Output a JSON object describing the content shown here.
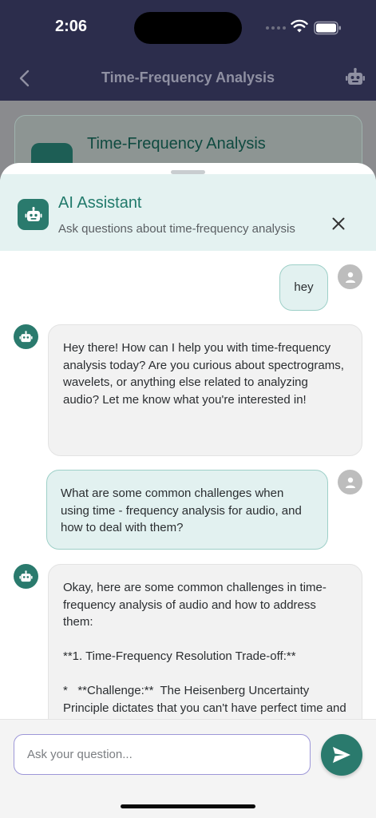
{
  "status_bar": {
    "time": "2:06"
  },
  "app_bar": {
    "title": "Time-Frequency Analysis"
  },
  "background_card": {
    "title": "Time-Frequency Analysis"
  },
  "assistant": {
    "title": "AI Assistant",
    "subtitle": "Ask questions about time-frequency analysis"
  },
  "messages": [
    {
      "role": "user",
      "text": "hey"
    },
    {
      "role": "bot",
      "text": "Hey there! How can I help you with time-frequency analysis today? Are you curious about spectrograms, wavelets, or anything else related to analyzing audio? Let me know what you're interested in!"
    },
    {
      "role": "user",
      "text": "What are some common challenges when using time - frequency analysis for audio, and how to deal with them?"
    },
    {
      "role": "bot",
      "text": "Okay, here are some common challenges in time-frequency analysis of audio and how to address them:\n\n**1. Time-Frequency Resolution Trade-off:**\n\n*   **Challenge:**  The Heisenberg Uncertainty Principle dictates that you can't have perfect time and frequency resolution"
    }
  ],
  "input": {
    "placeholder": "Ask your question...",
    "value": ""
  },
  "icons": {
    "back": "chevron-left-icon",
    "header_bot": "robot-icon",
    "close": "close-icon",
    "send": "send-icon",
    "user_avatar": "person-icon",
    "bot_avatar": "robot-icon"
  },
  "colors": {
    "app_bar": "#2c2d4c",
    "accent": "#2a7a6d",
    "user_bubble": "#e2f1f0",
    "bot_bubble": "#f2f2f2",
    "header_bg": "#e4f2f1"
  }
}
